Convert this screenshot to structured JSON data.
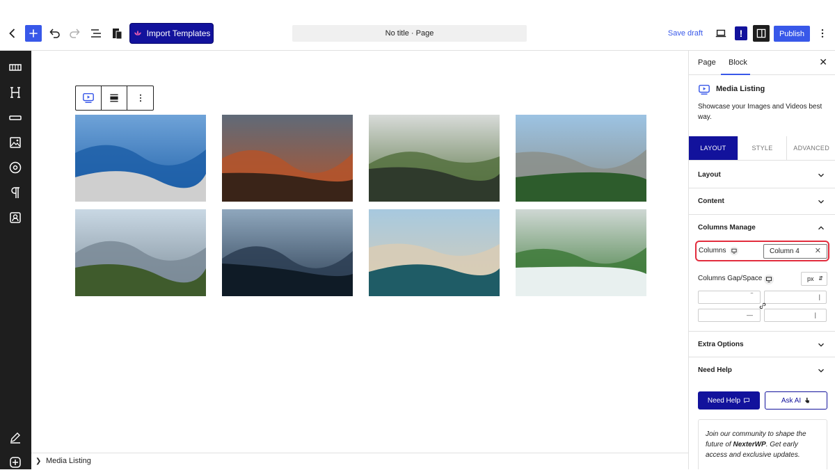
{
  "topbar": {
    "import_label": "Import Templates",
    "doc_title": "No title · Page",
    "save_draft": "Save draft",
    "publish": "Publish",
    "notice_glyph": "!"
  },
  "rail": {
    "icons": [
      "layout-grid-icon",
      "heading-icon",
      "divider-icon",
      "image-icon",
      "circle-icon",
      "paragraph-icon",
      "user-card-icon",
      "pencil-icon",
      "add-circle-icon"
    ]
  },
  "canvas": {
    "images": [
      {
        "name": "fjord-cliff",
        "colors": [
          "#6fa3d8",
          "#1d5fa8",
          "#cfcfcf"
        ]
      },
      {
        "name": "red-canyon",
        "colors": [
          "#5f6a78",
          "#b4542a",
          "#3a2418"
        ]
      },
      {
        "name": "green-ridge",
        "colors": [
          "#d8dbd9",
          "#55713f",
          "#2f3a2c"
        ]
      },
      {
        "name": "yosemite-valley",
        "colors": [
          "#9cc3e3",
          "#8b8f8a",
          "#2d5c2c"
        ]
      },
      {
        "name": "coastal-hills",
        "colors": [
          "#c9d8e4",
          "#7a8a96",
          "#3f5b2c"
        ]
      },
      {
        "name": "stormy-sea",
        "colors": [
          "#8fa7bd",
          "#2b3d52",
          "#0f1b26"
        ]
      },
      {
        "name": "sea-arches",
        "colors": [
          "#a7c9df",
          "#d9cdb5",
          "#1f5c66"
        ]
      },
      {
        "name": "waterfall-forest",
        "colors": [
          "#cfd8d4",
          "#3e7a3a",
          "#e8f0ef"
        ]
      }
    ]
  },
  "footer": {
    "breadcrumb": "Media Listing"
  },
  "panel": {
    "tabs": {
      "page": "Page",
      "block": "Block"
    },
    "block_name": "Media Listing",
    "block_desc": "Showcase your Images and Videos best way.",
    "layout_tabs": [
      "LAYOUT",
      "STYLE",
      "ADVANCED"
    ],
    "sections": {
      "layout": "Layout",
      "content": "Content",
      "columns_manage": "Columns Manage",
      "extra_options": "Extra Options",
      "need_help": "Need Help"
    },
    "columns_label": "Columns",
    "columns_value": "Column 4",
    "gap_label": "Columns Gap/Space",
    "gap_unit": "px",
    "help_button": "Need Help",
    "askai_button": "Ask AI",
    "community_text_1": "Join our community to shape the future of ",
    "community_brand": "NexterWP",
    "community_text_2": ". Get early access and exclusive updates."
  },
  "colors": {
    "accent": "#3858e9",
    "brand": "#12129c",
    "highlight": "#e22c3d"
  }
}
